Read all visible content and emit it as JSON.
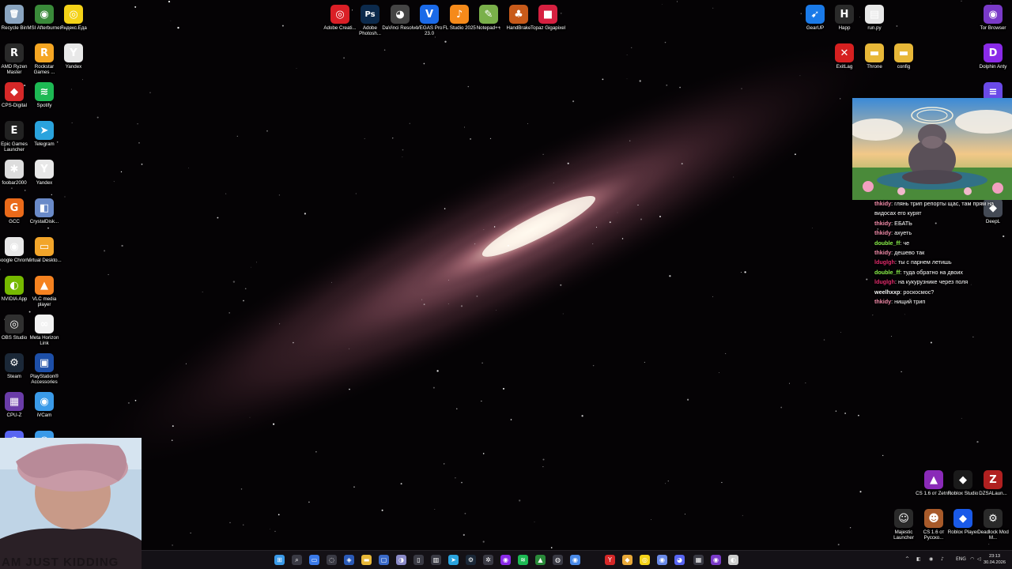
{
  "desktop": {
    "icons": [
      {
        "label": "Recycle Bin",
        "icon": "recycle-bin-icon",
        "glyph": "🗑",
        "color": "#8aa4c0"
      },
      {
        "label": "MSI Afterburner",
        "icon": "msi-afterburner-icon",
        "glyph": "◉",
        "color": "#3a8a3a"
      },
      {
        "label": "Яндекс.Еда",
        "icon": "yandex-eda-icon",
        "glyph": "◎",
        "color": "#f4d218"
      },
      {
        "label": "AMD Ryzen Master",
        "icon": "amd-ryzen-icon",
        "glyph": "R",
        "color": "#2a2a2a"
      },
      {
        "label": "Rockstar Games ...",
        "icon": "rockstar-icon",
        "glyph": "R",
        "color": "#f5a623"
      },
      {
        "label": "Yandex",
        "icon": "yandex-browser-icon",
        "glyph": "Y",
        "color": "#e8e8e8"
      },
      {
        "label": "CPS-Digital",
        "icon": "cps-digital-icon",
        "glyph": "◆",
        "color": "#d62828"
      },
      {
        "label": "Spotify",
        "icon": "spotify-icon",
        "glyph": "≋",
        "color": "#1db954"
      },
      {
        "label": "Epic Games Launcher",
        "icon": "epic-games-icon",
        "glyph": "E",
        "color": "#222222"
      },
      {
        "label": "Telegram",
        "icon": "telegram-icon",
        "glyph": "➤",
        "color": "#2aa3dd"
      },
      {
        "label": "foobar2000",
        "icon": "foobar-icon",
        "glyph": "✱",
        "color": "#dddddd"
      },
      {
        "label": "Yandex",
        "icon": "yandex-browser-icon",
        "glyph": "Y",
        "color": "#e8e8e8"
      },
      {
        "label": "GCC",
        "icon": "gcc-icon",
        "glyph": "G",
        "color": "#ea6a1a"
      },
      {
        "label": "CrystalDisk...",
        "icon": "crystaldisk-icon",
        "glyph": "◧",
        "color": "#6a8ac8"
      },
      {
        "label": "Google Chrome",
        "icon": "chrome-icon",
        "glyph": "◉",
        "color": "#e8e8e8"
      },
      {
        "label": "Virtual Deskto...",
        "icon": "virtual-desktop-icon",
        "glyph": "▭",
        "color": "#f2a52a"
      },
      {
        "label": "NVIDIA App",
        "icon": "nvidia-icon",
        "glyph": "◐",
        "color": "#76b900"
      },
      {
        "label": "VLC media player",
        "icon": "vlc-icon",
        "glyph": "▲",
        "color": "#f58220"
      },
      {
        "label": "OBS Studio",
        "icon": "obs-icon",
        "glyph": "◎",
        "color": "#303030"
      },
      {
        "label": "Meta Horizon Link",
        "icon": "meta-icon",
        "glyph": "∞",
        "color": "#f2f2f2"
      },
      {
        "label": "Steam",
        "icon": "steam-icon",
        "glyph": "⚙",
        "color": "#1b2838"
      },
      {
        "label": "PlayStation® Accessories",
        "icon": "playstation-icon",
        "glyph": "▣",
        "color": "#1d4fa8"
      },
      {
        "label": "CPU-Z",
        "icon": "cpuz-icon",
        "glyph": "▦",
        "color": "#6a3ca8"
      },
      {
        "label": "iVCam",
        "icon": "ivcam-icon",
        "glyph": "◉",
        "color": "#3a9ae8"
      },
      {
        "label": "",
        "icon": "discord-icon",
        "glyph": "◕",
        "color": "#5865f2"
      },
      {
        "label": "",
        "icon": "app-icon",
        "glyph": "◉",
        "color": "#3a9ae8"
      },
      {
        "label": "Adobe Creati...",
        "icon": "adobe-cc-icon",
        "glyph": "◎",
        "color": "#da1f26"
      },
      {
        "label": "Adobe Photosh...",
        "icon": "photoshop-icon",
        "glyph": "Ps",
        "color": "#0c2a4c"
      },
      {
        "label": "DaVinci Resolve",
        "icon": "davinci-icon",
        "glyph": "◕",
        "color": "#444444"
      },
      {
        "label": "VEGAS Pro 23.0",
        "icon": "vegas-icon",
        "glyph": "V",
        "color": "#1a6ae8"
      },
      {
        "label": "FL Studio 2025",
        "icon": "fl-studio-icon",
        "glyph": "♪",
        "color": "#f58a1a"
      },
      {
        "label": "Notepad++",
        "icon": "notepadpp-icon",
        "glyph": "✎",
        "color": "#7ab04a"
      },
      {
        "label": "HandBrake",
        "icon": "handbrake-icon",
        "glyph": "♣",
        "color": "#c85a1a"
      },
      {
        "label": "Topaz Gigapixel",
        "icon": "topaz-icon",
        "glyph": "■",
        "color": "#d62040"
      },
      {
        "label": "GearUP",
        "icon": "gearup-icon",
        "glyph": "➹",
        "color": "#1a7ae8"
      },
      {
        "label": "Happ",
        "icon": "happ-icon",
        "glyph": "H",
        "color": "#2a2a2a"
      },
      {
        "label": "run.py",
        "icon": "python-file-icon",
        "glyph": "▤",
        "color": "#e8e8e8"
      },
      {
        "label": "Tor Browser",
        "icon": "tor-browser-icon",
        "glyph": "◉",
        "color": "#7a3ac8"
      },
      {
        "label": "ExitLag",
        "icon": "exitlag-icon",
        "glyph": "✕",
        "color": "#d62020"
      },
      {
        "label": "Throne",
        "icon": "folder-icon",
        "glyph": "▬",
        "color": "#e8b838"
      },
      {
        "label": "config",
        "icon": "folder-icon",
        "glyph": "▬",
        "color": "#e8b838"
      },
      {
        "label": "Dolphin Anty",
        "icon": "dolphin-anty-icon",
        "glyph": "D",
        "color": "#8a2ae8"
      },
      {
        "label": "",
        "icon": "app-icon",
        "glyph": "≡",
        "color": "#6a4ae8"
      },
      {
        "label": "DeepL",
        "icon": "deepl-icon",
        "glyph": "◆",
        "color": "#444a55"
      },
      {
        "label": "CS 1.6 от Zetnfs",
        "icon": "cs16-icon",
        "glyph": "▲",
        "color": "#8a2ab8"
      },
      {
        "label": "Roblox Studio",
        "icon": "roblox-studio-icon",
        "glyph": "◆",
        "color": "#1a1a1a"
      },
      {
        "label": "DZSALaun...",
        "icon": "dzsa-icon",
        "glyph": "Z",
        "color": "#b02020"
      },
      {
        "label": "Majestic Launcher",
        "icon": "majestic-icon",
        "glyph": "☺",
        "color": "#2a2a2a"
      },
      {
        "label": "CS 1.6 от Русско...",
        "icon": "cs16-ru-icon",
        "glyph": "☻",
        "color": "#a85a2a"
      },
      {
        "label": "Roblox Player",
        "icon": "roblox-player-icon",
        "glyph": "◆",
        "color": "#1a5ae8"
      },
      {
        "label": "Deadlock Mod M...",
        "icon": "deadlock-icon",
        "glyph": "⚙",
        "color": "#2a2a2a"
      }
    ]
  },
  "chat": {
    "messages": [
      {
        "user": "thkidy",
        "color": "#f08aa8",
        "text": "глянь трип репорты щас, там прям на видосах его курят"
      },
      {
        "user": "thkidy",
        "color": "#f08aa8",
        "text": "ЕБАТЬ"
      },
      {
        "user": "thkidy",
        "color": "#f08aa8",
        "text": "ахуеть"
      },
      {
        "user": "double_ff",
        "color": "#8af04a",
        "text": "че"
      },
      {
        "user": "thkidy",
        "color": "#f08aa8",
        "text": "дешево так"
      },
      {
        "user": "lduglgh",
        "color": "#e02a6a",
        "text": "ты с парнем летишь"
      },
      {
        "user": "double_ff",
        "color": "#8af04a",
        "text": "туда обратно на двоих"
      },
      {
        "user": "lduglgh",
        "color": "#e02a6a",
        "text": "на кукурузнике через поля"
      },
      {
        "user": "weelhxxp",
        "color": "#f2f2f2",
        "text": "роскосмос?"
      },
      {
        "user": "thkidy",
        "color": "#f08aa8",
        "text": "нищий трип"
      }
    ]
  },
  "webcam": {
    "caption": "AM JUST KIDDING"
  },
  "taskbar": {
    "apps": [
      {
        "icon": "start-icon",
        "glyph": "⊞",
        "color": "#3a9ae8"
      },
      {
        "icon": "search-icon",
        "glyph": "⌕",
        "color": "#3a3a44"
      },
      {
        "icon": "file-explorer-icon",
        "glyph": "▭",
        "color": "#3a7ae8"
      },
      {
        "icon": "app-icon",
        "glyph": "◌",
        "color": "#3a3a44"
      },
      {
        "icon": "app-icon",
        "glyph": "◈",
        "color": "#2a5ab8"
      },
      {
        "icon": "folder-icon",
        "glyph": "▬",
        "color": "#e8b838"
      },
      {
        "icon": "app-icon",
        "glyph": "▢",
        "color": "#3a6ac8"
      },
      {
        "icon": "app-icon",
        "glyph": "◑",
        "color": "#8a8ac8"
      },
      {
        "icon": "app-icon",
        "glyph": "▯",
        "color": "#3a3a44"
      },
      {
        "icon": "app-icon",
        "glyph": "▥",
        "color": "#3a3a44"
      },
      {
        "icon": "telegram-icon",
        "glyph": "➤",
        "color": "#2aa3dd"
      },
      {
        "icon": "steam-icon",
        "glyph": "⚙",
        "color": "#1b2838"
      },
      {
        "icon": "chatgpt-icon",
        "glyph": "✲",
        "color": "#3a3a44"
      },
      {
        "icon": "app-icon",
        "glyph": "◉",
        "color": "#8a2ae8"
      },
      {
        "icon": "spotify-icon",
        "glyph": "≋",
        "color": "#1db954"
      },
      {
        "icon": "app-icon",
        "glyph": "▲",
        "color": "#2a8a3a"
      },
      {
        "icon": "app-icon",
        "glyph": "◍",
        "color": "#3a3a44"
      },
      {
        "icon": "chrome-icon",
        "glyph": "◉",
        "color": "#4a8ae8"
      },
      {
        "icon": "yandex-browser-icon",
        "glyph": "Y",
        "color": "#d62828"
      },
      {
        "icon": "app-icon",
        "glyph": "◆",
        "color": "#e8a838"
      },
      {
        "icon": "app-icon",
        "glyph": "◎",
        "color": "#f4d218"
      },
      {
        "icon": "app-icon",
        "glyph": "◉",
        "color": "#6a8ae8"
      },
      {
        "icon": "discord-icon",
        "glyph": "◕",
        "color": "#5865f2"
      },
      {
        "icon": "app-icon",
        "glyph": "▦",
        "color": "#3a3a44"
      },
      {
        "icon": "tor-browser-icon",
        "glyph": "◉",
        "color": "#7a3ac8"
      },
      {
        "icon": "app-icon",
        "glyph": "◐",
        "color": "#cccccc"
      }
    ],
    "tray": {
      "chevron": "^",
      "lang": "ENG",
      "clock_time": "23:13",
      "clock_date": "30.04.2026"
    }
  }
}
